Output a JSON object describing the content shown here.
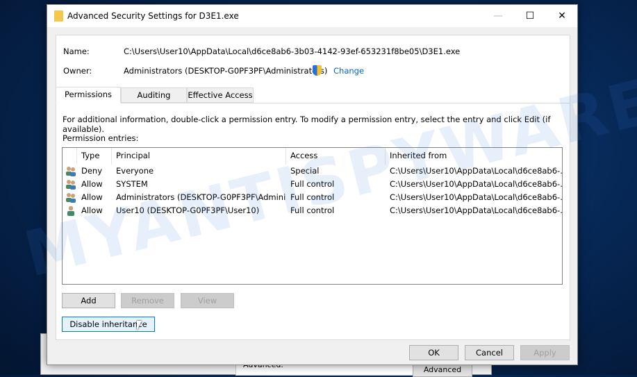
{
  "window": {
    "title": "Advanced Security Settings for D3E1.exe",
    "controls": {
      "minimize": "—",
      "maximize": "☐",
      "close": "✕"
    }
  },
  "info": {
    "name_label": "Name:",
    "name_value": "C:\\Users\\User10\\AppData\\Local\\d6ce8ab6-3b03-4142-93ef-653231f8be05\\D3E1.exe",
    "owner_label": "Owner:",
    "owner_value": "Administrators (DESKTOP-G0PF3PF\\Administrators)",
    "change_link": "Change"
  },
  "tabs": [
    {
      "label": "Permissions",
      "active": true
    },
    {
      "label": "Auditing"
    },
    {
      "label": "Effective Access"
    }
  ],
  "permissions": {
    "instructions": "For additional information, double-click a permission entry. To modify a permission entry, select the entry and click Edit (if available).",
    "entries_label": "Permission entries:",
    "columns": [
      "Type",
      "Principal",
      "Access",
      "Inherited from"
    ],
    "rows": [
      {
        "icon": "group-icon",
        "type": "Deny",
        "principal": "Everyone",
        "access": "Special",
        "inherited": "C:\\Users\\User10\\AppData\\Local\\d6ce8ab6-..."
      },
      {
        "icon": "group-icon",
        "type": "Allow",
        "principal": "SYSTEM",
        "access": "Full control",
        "inherited": "C:\\Users\\User10\\AppData\\Local\\d6ce8ab6-..."
      },
      {
        "icon": "group-icon",
        "type": "Allow",
        "principal": "Administrators (DESKTOP-G0PF3PF\\Admini...",
        "access": "Full control",
        "inherited": "C:\\Users\\User10\\AppData\\Local\\d6ce8ab6-..."
      },
      {
        "icon": "user-icon",
        "type": "Allow",
        "principal": "User10 (DESKTOP-G0PF3PF\\User10)",
        "access": "Full control",
        "inherited": "C:\\Users\\User10\\AppData\\Local\\d6ce8ab6-..."
      }
    ],
    "buttons": {
      "add": "Add",
      "remove": "Remove",
      "view": "View",
      "disable_inheritance": "Disable inheritance"
    }
  },
  "footer": {
    "ok": "OK",
    "cancel": "Cancel",
    "apply": "Apply"
  },
  "background_window": {
    "text": "For special permissions or advanced settings, click Advanced.",
    "advanced": "Advanced"
  },
  "watermark": "MYANTISPYWARE.COM"
}
